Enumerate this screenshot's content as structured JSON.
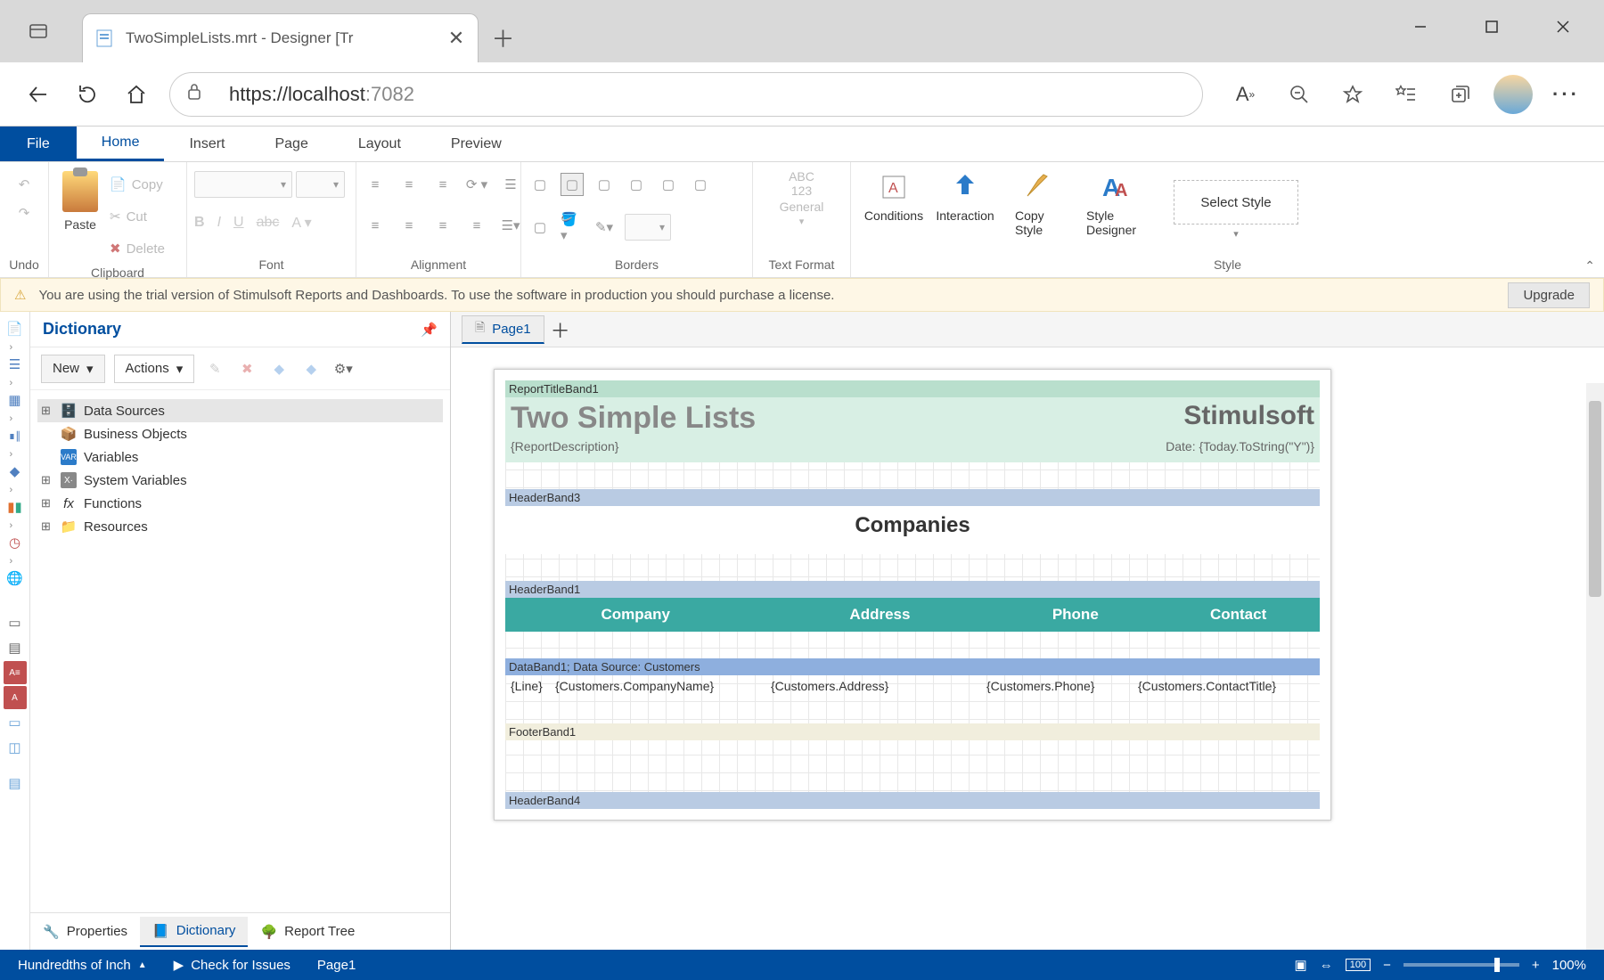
{
  "browser": {
    "tab_title": "TwoSimpleLists.mrt - Designer [Tr",
    "url_host": "https://localhost",
    "url_port": ":7082"
  },
  "menu": {
    "file": "File",
    "home": "Home",
    "insert": "Insert",
    "page": "Page",
    "layout": "Layout",
    "preview": "Preview"
  },
  "ribbon": {
    "undo": "Undo",
    "clipboard": {
      "label": "Clipboard",
      "paste": "Paste",
      "copy": "Copy",
      "cut": "Cut",
      "delete": "Delete"
    },
    "font": "Font",
    "alignment": "Alignment",
    "borders": "Borders",
    "textformat": {
      "label": "Text Format",
      "abc": "ABC",
      "num": "123",
      "general": "General"
    },
    "style": {
      "label": "Style",
      "conditions": "Conditions",
      "interaction": "Interaction",
      "copystyle": "Copy Style",
      "designer": "Style Designer",
      "select": "Select Style"
    }
  },
  "trial": {
    "msg": "You are using the trial version of Stimulsoft Reports and Dashboards. To use the software in production you should purchase a license.",
    "upgrade": "Upgrade"
  },
  "dictionary": {
    "title": "Dictionary",
    "new": "New",
    "actions": "Actions",
    "items": {
      "datasources": "Data Sources",
      "business": "Business Objects",
      "variables": "Variables",
      "sysvars": "System Variables",
      "functions": "Functions",
      "resources": "Resources"
    },
    "footer": {
      "properties": "Properties",
      "dict": "Dictionary",
      "reporttree": "Report Tree"
    }
  },
  "pagetab": "Page1",
  "bands": {
    "title_hdr": "ReportTitleBand1",
    "title_text": "Two Simple Lists",
    "brand": "Stimulsoft",
    "desc": "{ReportDescription}",
    "date": "Date: {Today.ToString(\"Y\")}",
    "header3": "HeaderBand3",
    "companies": "Companies",
    "header1": "HeaderBand1",
    "cols": {
      "c1": "Company",
      "c2": "Address",
      "c3": "Phone",
      "c4": "Contact"
    },
    "databand": "DataBand1; Data Source: Customers",
    "d1": "{Line}",
    "d1b": "{Customers.CompanyName}",
    "d2": "{Customers.Address}",
    "d3": "{Customers.Phone}",
    "d4": "{Customers.ContactTitle}",
    "footer1": "FooterBand1",
    "header4": "HeaderBand4"
  },
  "status": {
    "units": "Hundredths of Inch",
    "check": "Check for Issues",
    "page": "Page1",
    "zoom": "100%"
  }
}
